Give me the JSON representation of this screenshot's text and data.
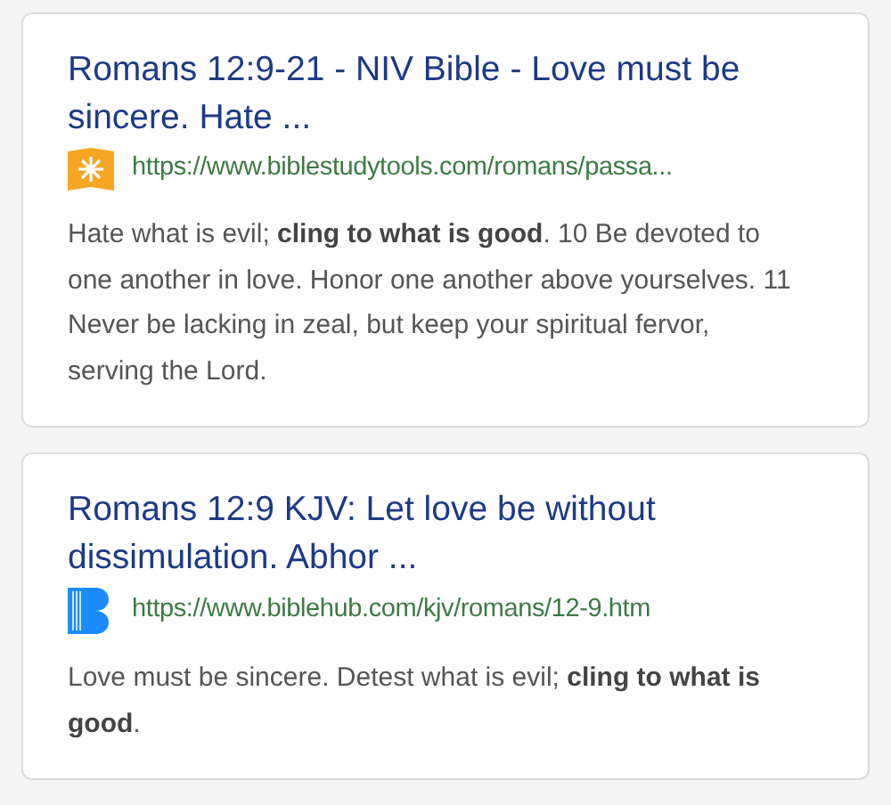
{
  "results": [
    {
      "title": "Romans 12:9-21 - NIV Bible - Love must be sincere. Hate ...",
      "favicon": {
        "kind": "sun"
      },
      "url": "https://www.biblestudytools.com/romans/passa...",
      "snippet": "Hate what is evil; **cling to what is good**. 10 Be devoted to one another in love. Honor one another above yourselves. 11 Never be lacking in zeal, but keep your spiritual fervor, serving the Lord."
    },
    {
      "title": "Romans 12:9 KJV: Let love be without dissimulation. Abhor ...",
      "favicon": {
        "kind": "letter-b"
      },
      "url": "https://www.biblehub.com/kjv/romans/12-9.htm",
      "snippet": "Love must be sincere. Detest what is evil; **cling to what is good**."
    }
  ]
}
